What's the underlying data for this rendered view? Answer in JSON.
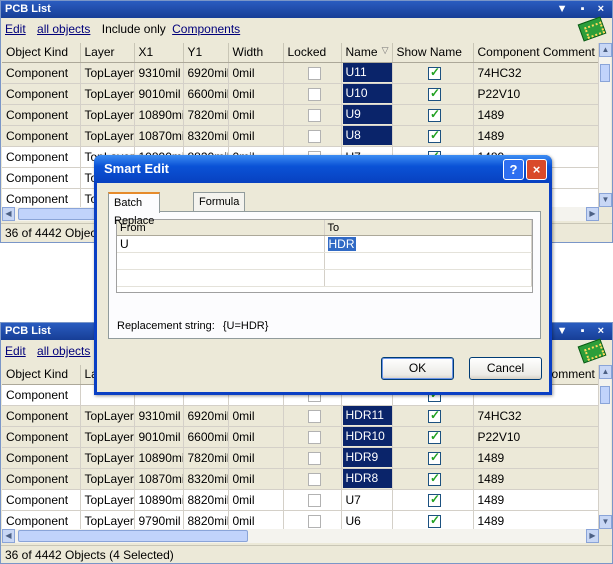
{
  "columns": [
    "Object Kind",
    "Layer",
    "X1",
    "Y1",
    "Width",
    "Locked",
    "Name",
    "Show Name",
    "Component Comment"
  ],
  "sort_icon": "sort-descending-icon",
  "top_panel": {
    "title": "PCB List",
    "title_buttons": "▼ ▪ ×",
    "toolbar": {
      "edit": "Edit",
      "all_objects": "all objects",
      "include_only": "Include only",
      "components": "Components"
    },
    "rows": [
      {
        "kind": "Component",
        "layer": "TopLayer",
        "x1": "9310mil",
        "y1": "6920mil",
        "width": "0mil",
        "locked": false,
        "name": "U11",
        "name_selected": true,
        "show_name": true,
        "comment": "74HC32",
        "shade": true
      },
      {
        "kind": "Component",
        "layer": "TopLayer",
        "x1": "9010mil",
        "y1": "6600mil",
        "width": "0mil",
        "locked": false,
        "name": "U10",
        "name_selected": true,
        "show_name": true,
        "comment": "P22V10",
        "shade": true
      },
      {
        "kind": "Component",
        "layer": "TopLayer",
        "x1": "10890mil",
        "y1": "7820mil",
        "width": "0mil",
        "locked": false,
        "name": "U9",
        "name_selected": true,
        "show_name": true,
        "comment": "1489",
        "shade": true
      },
      {
        "kind": "Component",
        "layer": "TopLayer",
        "x1": "10870mil",
        "y1": "8320mil",
        "width": "0mil",
        "locked": false,
        "name": "U8",
        "name_selected": true,
        "show_name": true,
        "comment": "1489",
        "shade": true
      },
      {
        "kind": "Component",
        "layer": "TopLayer",
        "x1": "10890mil",
        "y1": "8820mil",
        "width": "0mil",
        "locked": false,
        "name": "U7",
        "name_selected": false,
        "show_name": true,
        "comment": "1489",
        "shade": false
      },
      {
        "kind": "Component",
        "layer": "TopLayer",
        "x1": "",
        "y1": "",
        "width": "",
        "locked": false,
        "name": "",
        "name_selected": false,
        "show_name": true,
        "comment": "",
        "shade": false
      },
      {
        "kind": "Component",
        "layer": "TopLayer",
        "x1": "",
        "y1": "",
        "width": "",
        "locked": false,
        "name": "",
        "name_selected": false,
        "show_name": true,
        "comment": "",
        "shade": false
      }
    ],
    "status": "36 of 4442 Objects"
  },
  "bottom_panel": {
    "title": "PCB List",
    "title_buttons": "▼ ▪ ×",
    "toolbar": {
      "edit": "Edit",
      "all_objects": "all objects",
      "include_only": "I"
    },
    "rows": [
      {
        "kind": "Component",
        "layer": "",
        "x1": "",
        "y1": "",
        "width": "",
        "locked": false,
        "name": "",
        "name_selected": false,
        "show_name": true,
        "comment": "",
        "shade": false
      },
      {
        "kind": "Component",
        "layer": "TopLayer",
        "x1": "9310mil",
        "y1": "6920mil",
        "width": "0mil",
        "locked": false,
        "name": "HDR11",
        "name_selected": true,
        "show_name": true,
        "comment": "74HC32",
        "shade": true
      },
      {
        "kind": "Component",
        "layer": "TopLayer",
        "x1": "9010mil",
        "y1": "6600mil",
        "width": "0mil",
        "locked": false,
        "name": "HDR10",
        "name_selected": true,
        "show_name": true,
        "comment": "P22V10",
        "shade": true
      },
      {
        "kind": "Component",
        "layer": "TopLayer",
        "x1": "10890mil",
        "y1": "7820mil",
        "width": "0mil",
        "locked": false,
        "name": "HDR9",
        "name_selected": true,
        "show_name": true,
        "comment": "1489",
        "shade": true
      },
      {
        "kind": "Component",
        "layer": "TopLayer",
        "x1": "10870mil",
        "y1": "8320mil",
        "width": "0mil",
        "locked": false,
        "name": "HDR8",
        "name_selected": true,
        "show_name": true,
        "comment": "1489",
        "shade": true
      },
      {
        "kind": "Component",
        "layer": "TopLayer",
        "x1": "10890mil",
        "y1": "8820mil",
        "width": "0mil",
        "locked": false,
        "name": "U7",
        "name_selected": false,
        "show_name": true,
        "comment": "1489",
        "shade": false
      },
      {
        "kind": "Component",
        "layer": "TopLayer",
        "x1": "9790mil",
        "y1": "8820mil",
        "width": "0mil",
        "locked": false,
        "name": "U6",
        "name_selected": false,
        "show_name": true,
        "comment": "1489",
        "shade": false
      }
    ],
    "status": "36 of 4442 Objects (4 Selected)"
  },
  "dialog": {
    "title": "Smart Edit",
    "help_label": "?",
    "close_label": "×",
    "tabs": [
      "Batch Replace",
      "Formula"
    ],
    "active_tab": "Batch Replace",
    "grid_headers": {
      "from": "From",
      "to": "To"
    },
    "rows": [
      {
        "from": "U",
        "to": "HDR"
      },
      {
        "from": "",
        "to": ""
      },
      {
        "from": "",
        "to": ""
      }
    ],
    "replacement_label": "Replacement string:",
    "replacement_value": "{U=HDR}",
    "ok_label": "OK",
    "cancel_label": "Cancel"
  },
  "colors": {
    "selection": "#0a246a",
    "title_bar": "#0a52d6",
    "panel_bg": "#ece9d8"
  }
}
